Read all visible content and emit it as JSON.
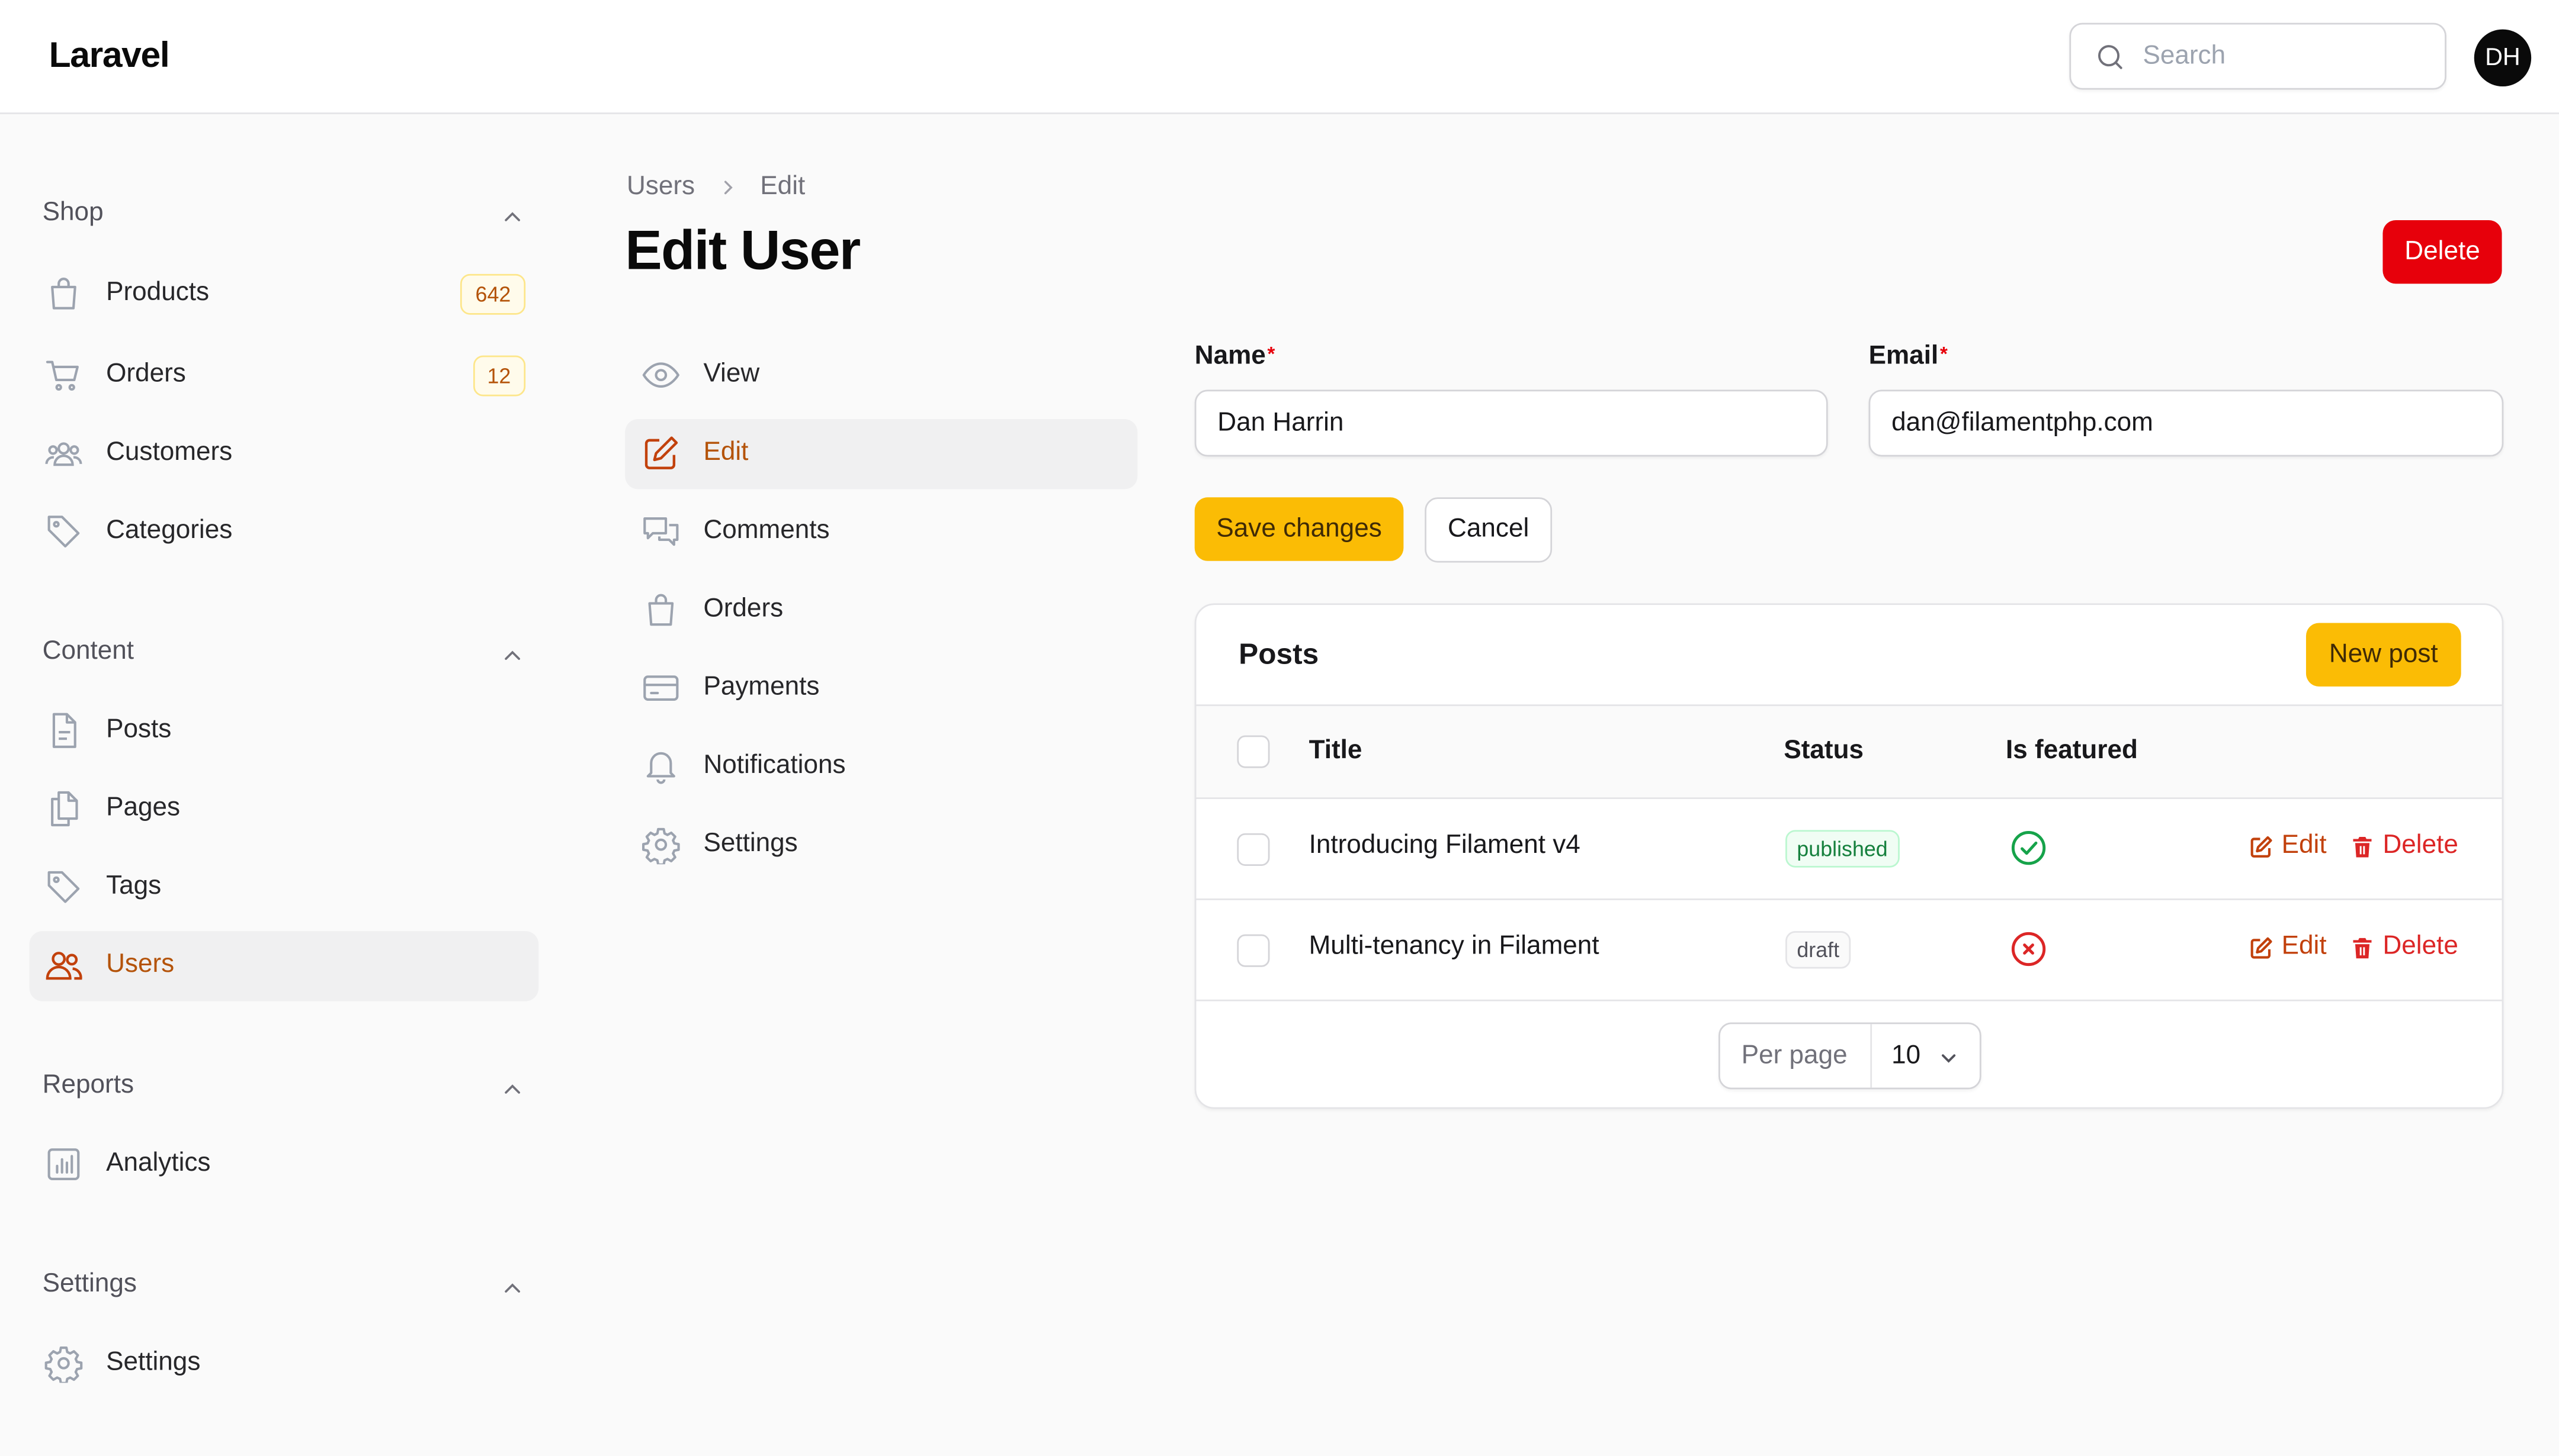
{
  "app": {
    "brand": "Laravel"
  },
  "topbar": {
    "search_placeholder": "Search",
    "avatar_initials": "DH"
  },
  "sidebar": {
    "groups": [
      {
        "label": "Shop",
        "items": [
          {
            "label": "Products",
            "badge": "642",
            "icon": "shopping-bag-icon"
          },
          {
            "label": "Orders",
            "badge": "12",
            "icon": "shopping-cart-icon"
          },
          {
            "label": "Customers",
            "icon": "users-group-icon"
          },
          {
            "label": "Categories",
            "icon": "tag-icon"
          }
        ]
      },
      {
        "label": "Content",
        "items": [
          {
            "label": "Posts",
            "icon": "document-icon"
          },
          {
            "label": "Pages",
            "icon": "documents-icon"
          },
          {
            "label": "Tags",
            "icon": "tag-icon"
          },
          {
            "label": "Users",
            "icon": "users-icon",
            "active": true
          }
        ]
      },
      {
        "label": "Reports",
        "items": [
          {
            "label": "Analytics",
            "icon": "chart-bar-icon"
          }
        ]
      },
      {
        "label": "Settings",
        "items": [
          {
            "label": "Settings",
            "icon": "gear-icon"
          }
        ]
      }
    ]
  },
  "breadcrumb": {
    "parent": "Users",
    "current": "Edit"
  },
  "page": {
    "title": "Edit User",
    "delete_label": "Delete"
  },
  "subnav": [
    {
      "label": "View",
      "icon": "eye-icon"
    },
    {
      "label": "Edit",
      "icon": "pencil-square-icon",
      "active": true
    },
    {
      "label": "Comments",
      "icon": "chat-bubbles-icon"
    },
    {
      "label": "Orders",
      "icon": "shopping-bag-icon"
    },
    {
      "label": "Payments",
      "icon": "credit-card-icon"
    },
    {
      "label": "Notifications",
      "icon": "bell-icon"
    },
    {
      "label": "Settings",
      "icon": "gear-icon"
    }
  ],
  "form": {
    "name_label": "Name",
    "name_value": "Dan Harrin",
    "email_label": "Email",
    "email_value": "dan@filamentphp.com",
    "required_marker": "*",
    "save_label": "Save changes",
    "cancel_label": "Cancel"
  },
  "posts": {
    "title": "Posts",
    "new_label": "New post",
    "columns": {
      "title": "Title",
      "status": "Status",
      "featured": "Is featured"
    },
    "rows": [
      {
        "title": "Introducing Filament v4",
        "status": "published",
        "featured": true
      },
      {
        "title": "Multi-tenancy in Filament",
        "status": "draft",
        "featured": false
      }
    ],
    "edit_label": "Edit",
    "delete_label": "Delete",
    "per_page_label": "Per page",
    "per_page_value": "10"
  },
  "colors": {
    "primary": "#fbbc05",
    "danger": "#e7000b",
    "active_text": "#b45309",
    "success": "#16a34a"
  }
}
